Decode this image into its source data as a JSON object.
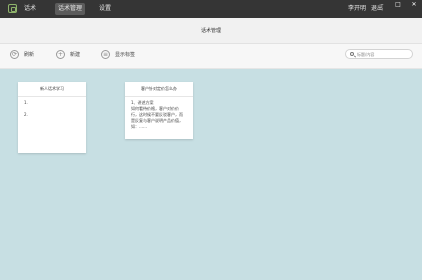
{
  "titlebar": {
    "nav": [
      "话术",
      "话术管理",
      "设置"
    ],
    "active_index": 1,
    "right": [
      "李开明",
      "退出"
    ],
    "window_buttons": [
      "–",
      "□",
      "✕"
    ]
  },
  "header": {
    "title": "话术管理"
  },
  "toolbar": {
    "refresh_label": "刷新",
    "new_label": "新建",
    "display_label": "显示标签",
    "search_placeholder": "标题/内容"
  },
  "cards": [
    {
      "title": "新人话术学习",
      "lines": [
        "1.",
        "",
        "2."
      ]
    },
    {
      "title": "客户针对定价怎么办",
      "lines": [
        "1、讲述方案",
        "如何看待价格，客户对价价",
        "行，这时候不要反驳客户，而",
        "是反复与客户说明产品价值，",
        "如：……"
      ]
    }
  ]
}
